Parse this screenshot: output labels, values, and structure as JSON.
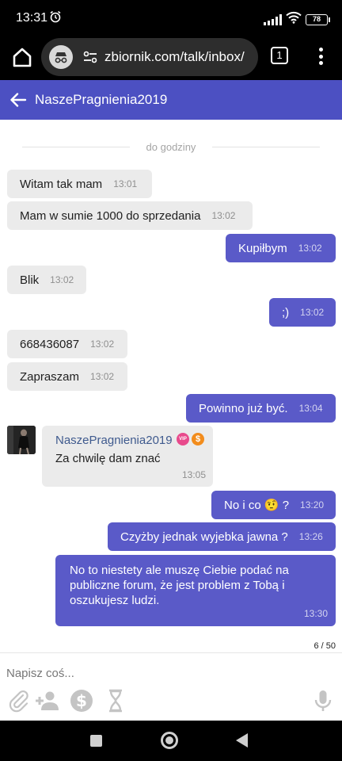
{
  "status_bar": {
    "time": "13:31",
    "battery": "78"
  },
  "browser": {
    "url": "zbiornik.com/talk/inbox/",
    "tab_count": "1"
  },
  "chat_header": {
    "contact_name": "NaszePragnienia2019"
  },
  "divider_label": "do godziny",
  "messages": [
    {
      "dir": "in",
      "text": "Witam tak mam",
      "time": "13:01"
    },
    {
      "dir": "in",
      "text": "Mam w sumie 1000 do sprzedania",
      "time": "13:02"
    },
    {
      "dir": "out",
      "text": "Kupiłbym",
      "time": "13:02"
    },
    {
      "dir": "in",
      "text": "Blik",
      "time": "13:02"
    },
    {
      "dir": "out",
      "text": ";)",
      "time": "13:02"
    },
    {
      "dir": "in",
      "text": "668436087",
      "time": "13:02"
    },
    {
      "dir": "in",
      "text": "Zapraszam",
      "time": "13:02"
    },
    {
      "dir": "out",
      "text": "Powinno już być.",
      "time": "13:04"
    },
    {
      "dir": "in",
      "author": "NaszePragnienia2019",
      "badges": [
        "VIP",
        "$"
      ],
      "text": "Za chwilę dam znać",
      "time": "13:05"
    },
    {
      "dir": "out",
      "text": "No i co 🤨 ?",
      "time": "13:20"
    },
    {
      "dir": "out",
      "text": "Czyżby jednak wyjebka jawna ?",
      "time": "13:26"
    },
    {
      "dir": "out",
      "text": "No to niestety ale muszę Ciebie podać na publiczne forum, że jest problem z Tobą i oszukujesz ludzi.",
      "time": "13:30"
    }
  ],
  "page_counter": "6 / 50",
  "composer": {
    "placeholder": "Napisz coś..."
  },
  "colors": {
    "header": "#4c50c2",
    "outgoing_bubble": "#5a5ac8",
    "incoming_bubble": "#ebebeb",
    "author_name": "#3f5a8e"
  }
}
